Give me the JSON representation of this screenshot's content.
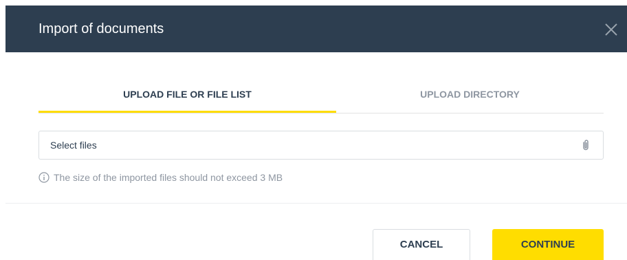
{
  "dialog": {
    "title": "Import of documents"
  },
  "tabs": [
    {
      "label": "UPLOAD FILE OR FILE LIST",
      "active": true
    },
    {
      "label": "UPLOAD DIRECTORY",
      "active": false
    }
  ],
  "file_input": {
    "placeholder": "Select files",
    "icon": "paperclip-icon"
  },
  "hint": {
    "icon": "info-icon",
    "text": "The size of the imported files should not exceed 3 MB"
  },
  "buttons": {
    "cancel_label": "CANCEL",
    "continue_label": "CONTINUE"
  },
  "colors": {
    "header_bg": "#2d3e50",
    "accent": "#ffdd00",
    "muted_text": "#8e96a1"
  }
}
